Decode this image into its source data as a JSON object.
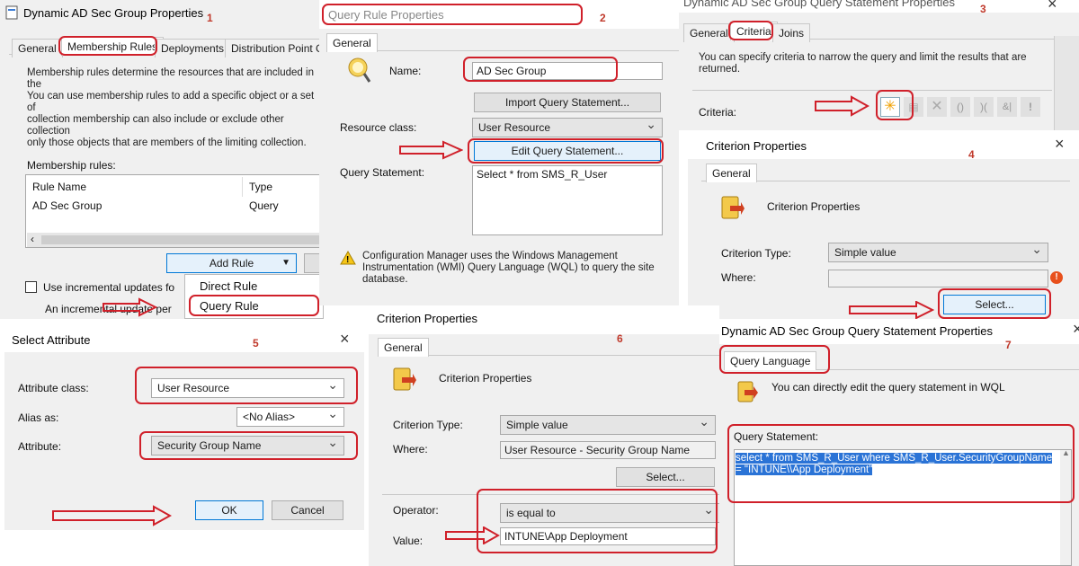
{
  "p1": {
    "title": "Dynamic AD Sec Group Properties",
    "num": "1",
    "tabs": [
      "General",
      "Membership Rules",
      "Deployments",
      "Distribution Point Grc"
    ],
    "desc": [
      "Membership rules determine the resources that are included in the",
      "You can use membership rules to add a specific object or a set of",
      "collection membership can also include or exclude other collection",
      "only those objects that are members of the limiting collection."
    ],
    "rules_label": "Membership rules:",
    "col_name": "Rule Name",
    "col_type": "Type",
    "row_name": "AD Sec Group",
    "row_type": "Query",
    "add_rule": "Add Rule",
    "incremental": "Use incremental updates fo",
    "incremental2": "An incremental update per",
    "menu": [
      "Direct Rule",
      "Query Rule"
    ]
  },
  "p2": {
    "title": "Query Rule Properties",
    "num": "2",
    "tab": "General",
    "name_label": "Name:",
    "name_value": "AD Sec Group",
    "import_btn": "Import Query Statement...",
    "resource_label": "Resource class:",
    "resource_value": "User Resource",
    "edit_btn": "Edit Query Statement...",
    "query_label": "Query Statement:",
    "query_value": "Select * from SMS_R_User",
    "warning": [
      "Configuration Manager uses the Windows Management",
      "Instrumentation (WMI) Query Language (WQL) to query the site",
      "database."
    ]
  },
  "p3": {
    "title": "Dynamic AD Sec Group Query Statement Properties",
    "num": "3",
    "tabs": [
      "General",
      "Criteria",
      "Joins"
    ],
    "desc": [
      "You can specify criteria to narrow the query and limit the results that are",
      "returned."
    ],
    "criteria_label": "Criteria:"
  },
  "p4": {
    "title": "Criterion Properties",
    "num": "4",
    "tab": "General",
    "heading": "Criterion Properties",
    "type_label": "Criterion Type:",
    "type_value": "Simple value",
    "where_label": "Where:",
    "where_value": "",
    "select_btn": "Select..."
  },
  "p5": {
    "title": "Select Attribute",
    "num": "5",
    "class_label": "Attribute class:",
    "class_value": "User Resource",
    "alias_label": "Alias as:",
    "alias_value": "<No Alias>",
    "attr_label": "Attribute:",
    "attr_value": "Security Group Name",
    "ok": "OK",
    "cancel": "Cancel"
  },
  "p6": {
    "title": "Criterion Properties",
    "num": "6",
    "tab": "General",
    "heading": "Criterion Properties",
    "type_label": "Criterion Type:",
    "type_value": "Simple value",
    "where_label": "Where:",
    "where_value": "User Resource - Security Group Name",
    "select_btn": "Select...",
    "op_label": "Operator:",
    "op_value": "is equal to",
    "value_label": "Value:",
    "value_value": "INTUNE\\App Deployment"
  },
  "p7": {
    "title": "Dynamic AD Sec Group Query Statement Properties",
    "num": "7",
    "tab": "Query Language",
    "desc": "You can directly edit the query statement in WQL",
    "stmt_label": "Query Statement:",
    "stmt_line1": "select * from  SMS_R_User where SMS_R_User.SecurityGroupName",
    "stmt_line2": "= \"INTUNE\\\\App Deployment\""
  },
  "colors": {
    "annotation": "#d0202a",
    "selection": "#2a73d6",
    "dialog_bg": "#f0f0f0"
  }
}
